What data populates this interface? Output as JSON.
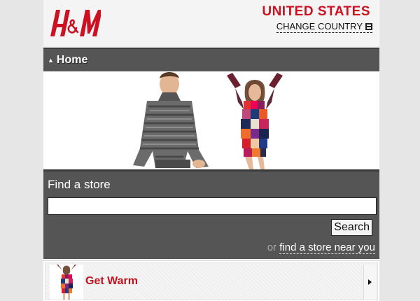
{
  "header": {
    "logo_text": "H&M",
    "country": "UNITED STATES",
    "change_country_label": "CHANGE COUNTRY",
    "change_country_icon": "swap-icon"
  },
  "nav": {
    "home_icon": "home-icon",
    "home_label": "Home"
  },
  "find_store": {
    "title": "Find a store",
    "input_value": "",
    "input_placeholder": "",
    "search_label": "Search",
    "or_text": "or",
    "near_link": "find a store near you"
  },
  "promo": {
    "title": "Get Warm",
    "arrow_icon": "chevron-right-icon"
  },
  "colors": {
    "brand_red": "#cc1122",
    "bar_gray": "#555555",
    "page_bg": "#e6e6e6"
  }
}
